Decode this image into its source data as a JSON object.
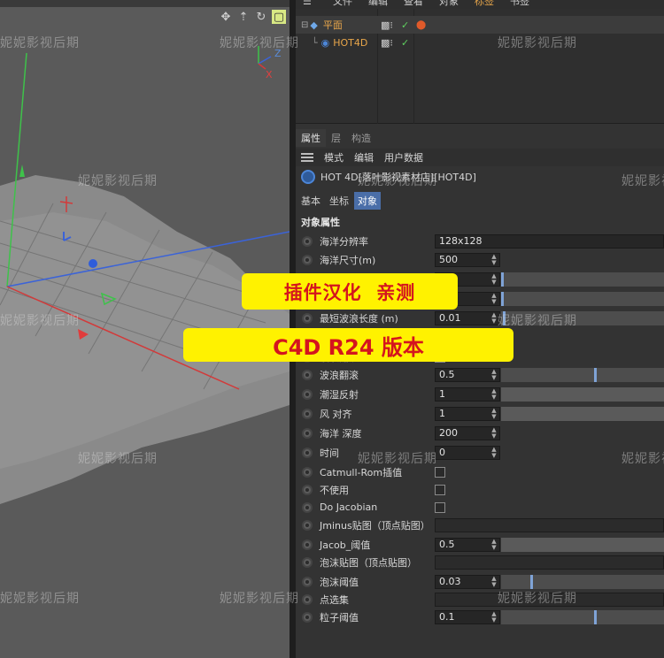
{
  "menubar": {
    "items": [
      "文件",
      "编辑",
      "查看",
      "对象",
      "标签",
      "书签"
    ]
  },
  "objects": [
    {
      "name": "平面"
    },
    {
      "name": "HOT4D"
    }
  ],
  "attributes": {
    "tabs": [
      "属性",
      "层",
      "构造"
    ],
    "menu": [
      "模式",
      "编辑",
      "用户数据"
    ],
    "object_title": "HOT 4D[落叶影视素材店][HOT4D]",
    "sub_tabs": [
      "基本",
      "坐标",
      "对象"
    ],
    "section": "对象属性",
    "props": [
      {
        "label": "海洋分辨率",
        "value": "128x128",
        "kind": "wide"
      },
      {
        "label": "海洋尺寸(m)",
        "value": "500",
        "kind": "num"
      },
      {
        "label": "",
        "value": "",
        "kind": "num-slider",
        "knob": 0
      },
      {
        "label": "",
        "value": "",
        "kind": "num-slider",
        "knob": 0
      },
      {
        "label": "最短波浪长度 (m)",
        "value": "0.01",
        "kind": "num-slider",
        "knob": 0.01
      },
      {
        "label": "波浪翻滚",
        "value": "",
        "kind": "check",
        "checked": true
      },
      {
        "label": "波浪翻滚",
        "value": "0.5",
        "kind": "num-slider",
        "knob": 0.58
      },
      {
        "label": "潮湿反射",
        "value": "1",
        "kind": "num-slider",
        "knob": 1
      },
      {
        "label": "风 对齐",
        "value": "1",
        "kind": "num-slider",
        "knob": 1
      },
      {
        "label": "海洋 深度",
        "value": "200",
        "kind": "num"
      },
      {
        "label": "时间",
        "value": "0",
        "kind": "num"
      },
      {
        "label": "Catmull-Rom插值",
        "value": "",
        "kind": "check",
        "checked": false
      },
      {
        "label": "不使用",
        "value": "",
        "kind": "check",
        "checked": false
      },
      {
        "label": "Do Jacobian",
        "value": "",
        "kind": "check",
        "checked": false
      },
      {
        "label": "Jminus贴图（顶点贴图）",
        "value": "",
        "kind": "link"
      },
      {
        "label": "Jacob_阈值",
        "value": "0.5",
        "kind": "num-slider",
        "knob": 1
      },
      {
        "label": "泡沫贴图（顶点贴图）",
        "value": "",
        "kind": "link"
      },
      {
        "label": "泡沫阈值",
        "value": "0.03",
        "kind": "num-slider",
        "knob": 0.18
      },
      {
        "label": "点选集",
        "value": "",
        "kind": "link"
      },
      {
        "label": "粒子阈值",
        "value": "0.1",
        "kind": "num-slider",
        "knob": 0.58
      }
    ]
  },
  "banners": {
    "line1": "插件汉化  亲测",
    "line2": "C4D R24 版本"
  },
  "watermark": "妮妮影视后期",
  "viewport": {
    "axis_labels": {
      "z": "Z",
      "x": "X"
    }
  }
}
